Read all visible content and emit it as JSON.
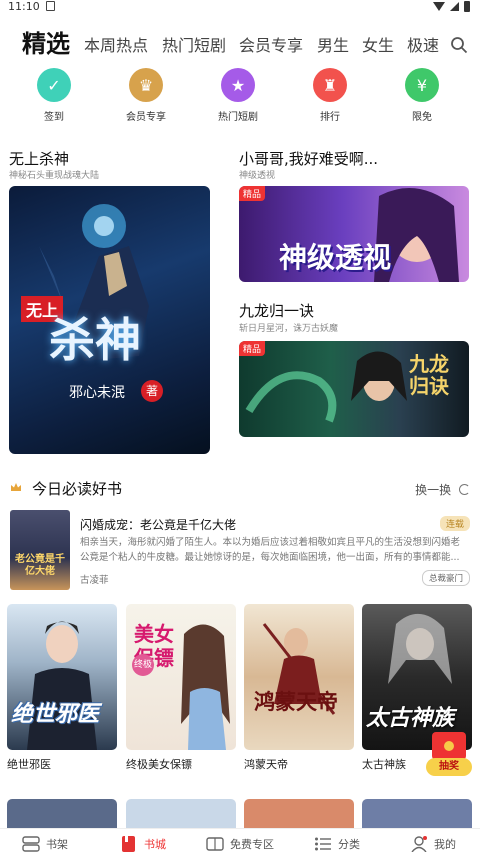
{
  "status": {
    "time": "11:10"
  },
  "tabs": [
    "精选",
    "本周热点",
    "热门短剧",
    "会员专享",
    "男生",
    "女生",
    "极速"
  ],
  "quick": [
    {
      "label": "签到",
      "color": "#3fd1b8",
      "icon": "check-calendar-icon",
      "glyph": "✓"
    },
    {
      "label": "会员专享",
      "color": "#d7a24c",
      "icon": "crown-icon",
      "glyph": "♛"
    },
    {
      "label": "热门短剧",
      "color": "#a55be8",
      "icon": "star-icon",
      "glyph": "★"
    },
    {
      "label": "排行",
      "color": "#f2524d",
      "icon": "trophy-icon",
      "glyph": "♜"
    },
    {
      "label": "限免",
      "color": "#3fc86a",
      "icon": "free-tag-icon",
      "glyph": "¥"
    }
  ],
  "featured": {
    "main": {
      "title": "无上杀神",
      "sub": "神秘石头重现战魂大陆",
      "cover_text": "无上杀神",
      "author_text": "邪心未泯"
    },
    "second": {
      "title": "小哥哥,我好难受啊...",
      "sub": "神级透视",
      "badge": "精品",
      "cover_text": "神级透视"
    },
    "third": {
      "title": "九龙归一诀",
      "sub": "斩日月星河，诛万古妖魔",
      "badge": "精品",
      "cover_text": "九龙归诀"
    }
  },
  "section": {
    "title": "今日必读好书",
    "refresh": "换一换"
  },
  "recommend": {
    "title": "闪婚成宠：老公竟是千亿大佬",
    "tag": "连载",
    "desc": "相亲当天，海彤就闪婚了陌生人。本以为婚后应该过着相敬如宾且平凡的生活没想到闪婚老公竟是个粘人的牛皮糖。最让她惊讶的是，每次她面临困境，他一出面，所有的事情都能...",
    "author": "古凌菲",
    "genre": "总裁豪门",
    "thumb_text": "老公竟是千亿大佬"
  },
  "grid": [
    {
      "name": "绝世邪医",
      "cover_text": "绝世邪医"
    },
    {
      "name": "终极美女保镖",
      "cover_text": "美女保镖"
    },
    {
      "name": "鸿蒙天帝",
      "cover_text": "鸿蒙天帝"
    },
    {
      "name": "太古神族",
      "cover_text": "太古神族"
    }
  ],
  "lottery": {
    "label": "抽奖"
  },
  "nav": [
    {
      "label": "书架",
      "icon": "bookshelf-icon"
    },
    {
      "label": "书城",
      "icon": "bookstore-icon"
    },
    {
      "label": "免费专区",
      "icon": "free-zone-icon"
    },
    {
      "label": "分类",
      "icon": "category-icon"
    },
    {
      "label": "我的",
      "icon": "profile-icon"
    }
  ],
  "colors": {
    "accent": "#e33333"
  }
}
